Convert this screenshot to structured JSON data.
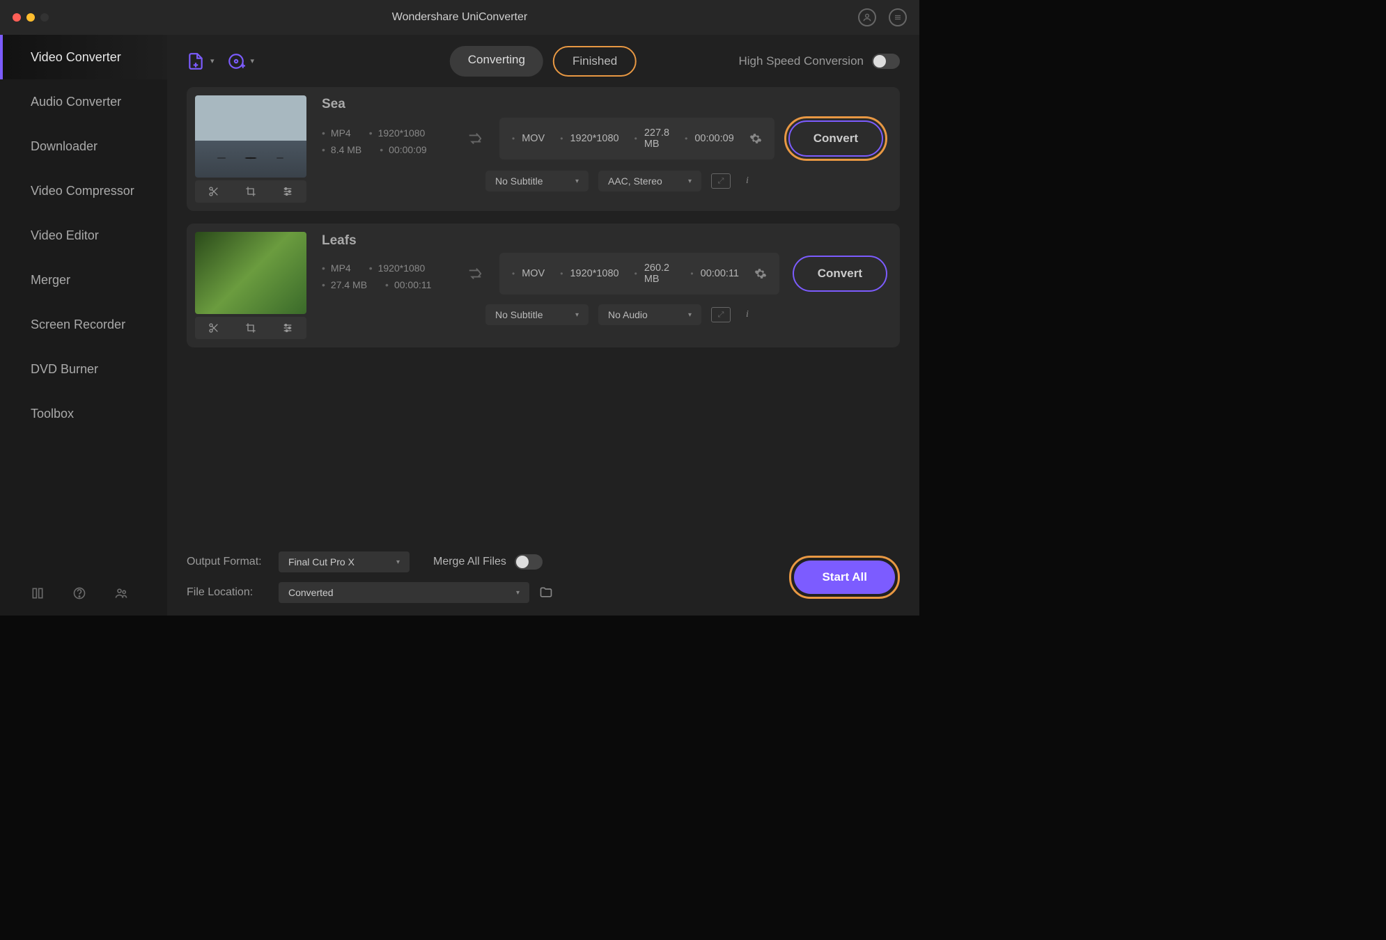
{
  "app_title": "Wondershare UniConverter",
  "sidebar": {
    "items": [
      {
        "label": "Video Converter",
        "active": true
      },
      {
        "label": "Audio Converter"
      },
      {
        "label": "Downloader"
      },
      {
        "label": "Video Compressor"
      },
      {
        "label": "Video Editor"
      },
      {
        "label": "Merger"
      },
      {
        "label": "Screen Recorder"
      },
      {
        "label": "DVD Burner"
      },
      {
        "label": "Toolbox"
      }
    ]
  },
  "toolbar": {
    "tabs": {
      "converting": "Converting",
      "finished": "Finished"
    },
    "hs_label": "High Speed Conversion"
  },
  "files": [
    {
      "title": "Sea",
      "src": {
        "format": "MP4",
        "res": "1920*1080",
        "size": "8.4 MB",
        "dur": "00:00:09"
      },
      "dest": {
        "format": "MOV",
        "res": "1920*1080",
        "size": "227.8 MB",
        "dur": "00:00:09"
      },
      "subtitle": "No Subtitle",
      "audio": "AAC, Stereo",
      "convert_label": "Convert",
      "highlight": true
    },
    {
      "title": "Leafs",
      "src": {
        "format": "MP4",
        "res": "1920*1080",
        "size": "27.4 MB",
        "dur": "00:00:11"
      },
      "dest": {
        "format": "MOV",
        "res": "1920*1080",
        "size": "260.2 MB",
        "dur": "00:00:11"
      },
      "subtitle": "No Subtitle",
      "audio": "No Audio",
      "convert_label": "Convert",
      "highlight": false
    }
  ],
  "bottom": {
    "output_format_label": "Output Format:",
    "output_format_value": "Final Cut Pro X",
    "file_location_label": "File Location:",
    "file_location_value": "Converted",
    "merge_label": "Merge All Files",
    "start_all_label": "Start All"
  }
}
